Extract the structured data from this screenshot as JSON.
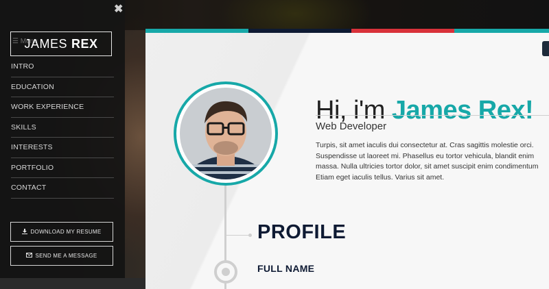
{
  "sidebar": {
    "brand_first": "JAMES",
    "brand_last": "REX",
    "menu_ghost": "☰ Menu",
    "close_glyph": "✖",
    "nav": [
      "INTRO",
      "EDUCATION",
      "WORK EXPERIENCE",
      "SKILLS",
      "INTERESTS",
      "PORTFOLIO",
      "CONTACT"
    ],
    "download_label": "DOWNLOAD MY RESUME",
    "message_label": "SEND ME A MESSAGE",
    "download_icon": "download-icon",
    "message_icon": "envelope-icon"
  },
  "hero": {
    "greeting": "Hi, i'm ",
    "name": "James Rex!",
    "role": "Web Developer",
    "bio": "Turpis, sit amet iaculis dui consectetur at. Cras sagittis molestie orci. Suspendisse ut laoreet mi. Phasellus eu tortor vehicula, blandit enim massa. Nulla ultricies tortor dolor, sit amet suscipit enim condimentum Etiam eget iaculis tellus. Varius sit amet."
  },
  "profile": {
    "heading": "PROFILE",
    "full_name_label": "FULL NAME"
  },
  "colors": {
    "accent": "#17a8a8",
    "navy": "#0e1a33",
    "stripe": [
      "#17a8a8",
      "#0e1a33",
      "#d9323a",
      "#17a8a8"
    ]
  }
}
